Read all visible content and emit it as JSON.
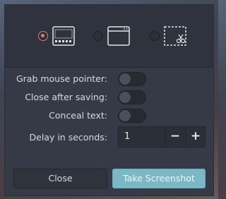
{
  "modes": [
    {
      "name": "Fullscreen",
      "selected": true,
      "icon": "fullscreen-icon"
    },
    {
      "name": "Window",
      "selected": false,
      "icon": "window-icon"
    },
    {
      "name": "Area",
      "selected": false,
      "icon": "area-selection-icon"
    }
  ],
  "options": {
    "grab_pointer_label": "Grab mouse pointer:",
    "grab_pointer_on": false,
    "close_after_label": "Close after saving:",
    "close_after_on": false,
    "conceal_label": "Conceal text:",
    "conceal_on": false,
    "delay_label": "Delay in seconds:",
    "delay_value": "1",
    "minus": "−",
    "plus": "+"
  },
  "buttons": {
    "close_label": "Close",
    "take_label": "Take Screenshot"
  },
  "colors": {
    "accent_radio": "#e07a6a",
    "primary_button": "#79b8c4",
    "dialog_bg": "#353a46"
  }
}
